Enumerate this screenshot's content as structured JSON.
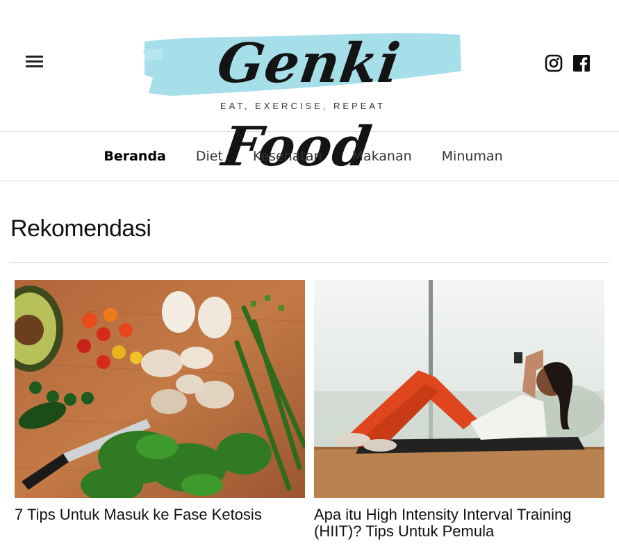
{
  "header": {
    "logo_text": "Genki Food",
    "tagline": "EAT, EXERCISE, REPEAT",
    "menu_icon": "hamburger-menu-icon",
    "social_icons": [
      "instagram-icon",
      "facebook-icon"
    ],
    "logo_accent_color": "#a6dfe9"
  },
  "nav": {
    "items": [
      {
        "label": "Beranda",
        "active": true
      },
      {
        "label": "Diet",
        "active": false
      },
      {
        "label": "Kesehatan",
        "active": false
      },
      {
        "label": "Makanan",
        "active": false
      },
      {
        "label": "Minuman",
        "active": false
      }
    ]
  },
  "main": {
    "section_title": "Rekomendasi",
    "articles": [
      {
        "title": "7 Tips Untuk Masuk ke Fase Ketosis"
      },
      {
        "title": "Apa itu High Intensity Interval Training (HIIT)? Tips Untuk Pemula"
      }
    ]
  }
}
